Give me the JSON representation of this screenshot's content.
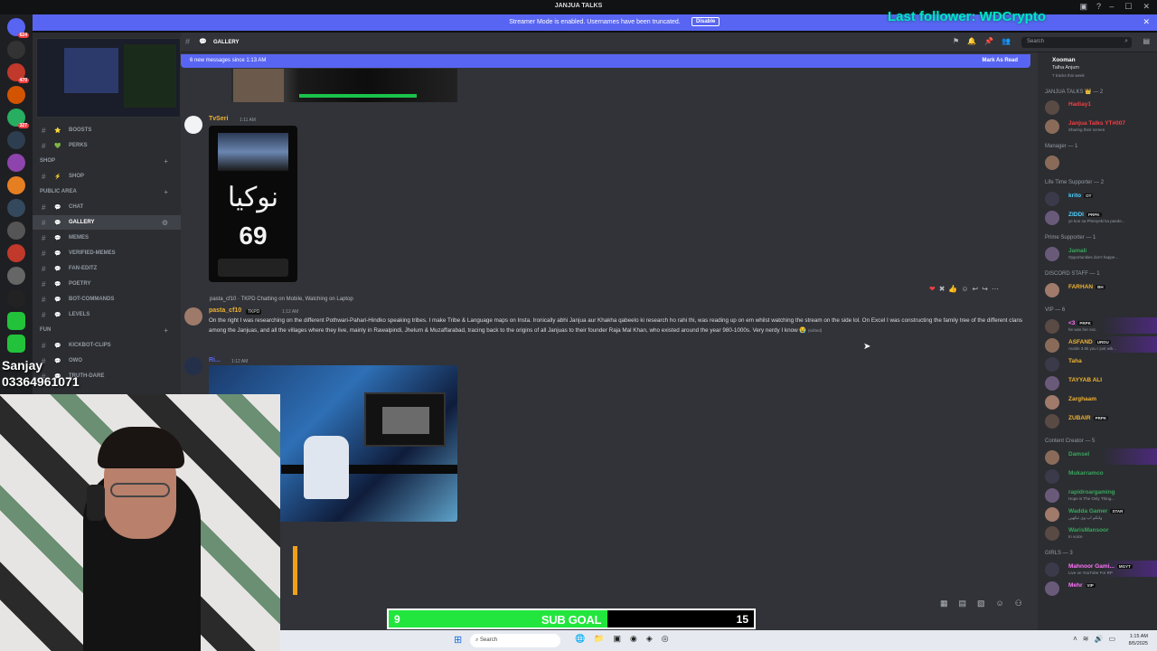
{
  "window": {
    "title": "JANJUA TALKS"
  },
  "stream_banner": {
    "text": "Streamer Mode is enabled. Usernames have been truncated.",
    "button": "Disable"
  },
  "overlay": {
    "last_follower": "Last follower: WDCrypto",
    "webcam_caption_line1": "Sanjay",
    "webcam_caption_line2": "03364961071",
    "sub_goal": {
      "label": "SUB GOAL",
      "current": "9",
      "target": "15",
      "progress": 0.6
    }
  },
  "guild_badges": [
    "624",
    "470",
    "327"
  ],
  "channel_list": [
    {
      "kind": "channel",
      "emoji": "⭐",
      "name": "boosts"
    },
    {
      "kind": "channel",
      "emoji": "💚",
      "name": "perks"
    },
    {
      "kind": "category",
      "name": "SHOP"
    },
    {
      "kind": "channel",
      "emoji": "⚡",
      "name": "shop"
    },
    {
      "kind": "category",
      "name": "PUBLIC AREA"
    },
    {
      "kind": "channel",
      "emoji": "💬",
      "name": "chat"
    },
    {
      "kind": "channel",
      "emoji": "💬",
      "name": "gallery",
      "active": true
    },
    {
      "kind": "channel",
      "emoji": "💬",
      "name": "memes"
    },
    {
      "kind": "channel",
      "emoji": "💬",
      "name": "verified-memes"
    },
    {
      "kind": "channel",
      "emoji": "💬",
      "name": "fan-editz"
    },
    {
      "kind": "channel",
      "emoji": "💬",
      "name": "poetry"
    },
    {
      "kind": "channel",
      "emoji": "💬",
      "name": "bot-commands"
    },
    {
      "kind": "channel",
      "emoji": "💬",
      "name": "levels"
    },
    {
      "kind": "category",
      "name": "FUN"
    },
    {
      "kind": "channel",
      "emoji": "💬",
      "name": "kickbot-clips"
    },
    {
      "kind": "channel",
      "emoji": "💬",
      "name": "owo"
    },
    {
      "kind": "channel",
      "emoji": "💬",
      "name": "truth-dare"
    }
  ],
  "header": {
    "channel": "GALLERY",
    "search_placeholder": "Search"
  },
  "new_messages": {
    "text": "6 new messages since 1:13 AM",
    "mark_read": "Mark As Read"
  },
  "messages": [
    {
      "author": "TvSeri",
      "time": "1:11 AM",
      "image_text_urdu": "نوکیا",
      "image_text_num": "69"
    },
    {
      "reply_context": "pasta_cf10 · TKPD Chatting on Mobile, Watching on Laptop",
      "author": "pasta_cf10",
      "tag": "TKPD",
      "time": "1:12 AM",
      "text": "On the right I was researching on the different Pothwari-Pahari-Hindko speaking tribes. I make Tribe & Language maps on Insta. Ironically abhi Janjua aur Khakha qabeelo ki research ho rahi thi, was reading up on em whilst watching the stream on the side lol. On Excel I was constructing the family tree of the different clans among the Janjuas, and all the villages where they live, mainly in Rawalpindi, Jhelum & Muzaffarabad, tracing back to the origins of all Janjuas to their founder Raja Mal Khan, who existed around the year 980-1000s. Very nerdy I know 😭",
      "edited": "(edited)"
    },
    {
      "author": "Ri...",
      "time": "1:12 AM"
    }
  ],
  "members": {
    "top": {
      "name": "Xooman",
      "sub1": "Talha Anjum",
      "sub2": "7 tracks this week"
    },
    "groups": [
      {
        "title": "JANJUA TALKS 👑 — 2",
        "items": [
          {
            "name": "Hadiay1",
            "color": "#f23f43"
          },
          {
            "name": "Janjua Talks YT#007",
            "color": "#f23f43",
            "status": "Sharing their screen"
          }
        ]
      },
      {
        "title": "Manager — 1",
        "items": [
          {
            "name": "",
            "color": "#949ba4"
          }
        ]
      },
      {
        "title": "Life Time Supporter — 2",
        "items": [
          {
            "name": "krito",
            "color": "#4fd0ff",
            "tag": "OT"
          },
          {
            "name": "ZIDDI",
            "color": "#4fd0ff",
            "tag": "PRPK",
            "status": "ye kon sa Phenyeki ka paede..."
          }
        ]
      },
      {
        "title": "Prime Supporter — 1",
        "items": [
          {
            "name": "Jamali",
            "color": "#3ba55d",
            "status": "Opportunities don't happe..."
          }
        ]
      },
      {
        "title": "DISCORD STAFF — 1",
        "items": [
          {
            "name": "FARHAN",
            "color": "#f0b232",
            "tag": "BH"
          }
        ]
      },
      {
        "title": "VIP — 6",
        "items": [
          {
            "name": "<3",
            "color": "#ff73fa",
            "tag": "PRPK",
            "status": "he was her exc.",
            "hl": true
          },
          {
            "name": "ASFAND",
            "color": "#f0b232",
            "tag": "URDU",
            "status": "Austin 3.5k you I just wik...",
            "hl": true
          },
          {
            "name": "Taha",
            "color": "#f0b232"
          },
          {
            "name": "TAYYAB ALI",
            "color": "#f0b232"
          },
          {
            "name": "Zarghaam",
            "color": "#f0b232"
          },
          {
            "name": "ZUBAIR",
            "color": "#f0b232",
            "tag": "PRPK"
          }
        ]
      },
      {
        "title": "Content Creator — 5",
        "items": [
          {
            "name": "Damsel",
            "color": "#3ba55d",
            "hl": true
          },
          {
            "name": "Mukarramco",
            "color": "#3ba55d"
          },
          {
            "name": "rapidroargaming",
            "color": "#3ba55d",
            "status": "Hope is The Only Thing..."
          },
          {
            "name": "Wadda Gamer",
            "color": "#3ba55d",
            "tag": "STAR",
            "status": "ولنکم اپ وی تیکھیں"
          },
          {
            "name": "WarisMansoor",
            "color": "#3ba55d",
            "status": "In voice"
          }
        ]
      },
      {
        "title": "GIRLS — 3",
        "items": [
          {
            "name": "Mahnoor Gami...",
            "color": "#ff73fa",
            "tag": "MGYT",
            "status": "Live on YouTube For RP",
            "hl": true
          },
          {
            "name": "Mehr",
            "color": "#ff73fa",
            "tag": "VIP"
          }
        ]
      }
    ]
  },
  "taskbar": {
    "search": "Search",
    "time": "1:15 AM",
    "date": "8/5/2025"
  },
  "colors": {
    "blurple": "#5865f2",
    "bg": "#313338",
    "sidebar": "#2b2d31",
    "subgoal_green": "#22e63d"
  }
}
